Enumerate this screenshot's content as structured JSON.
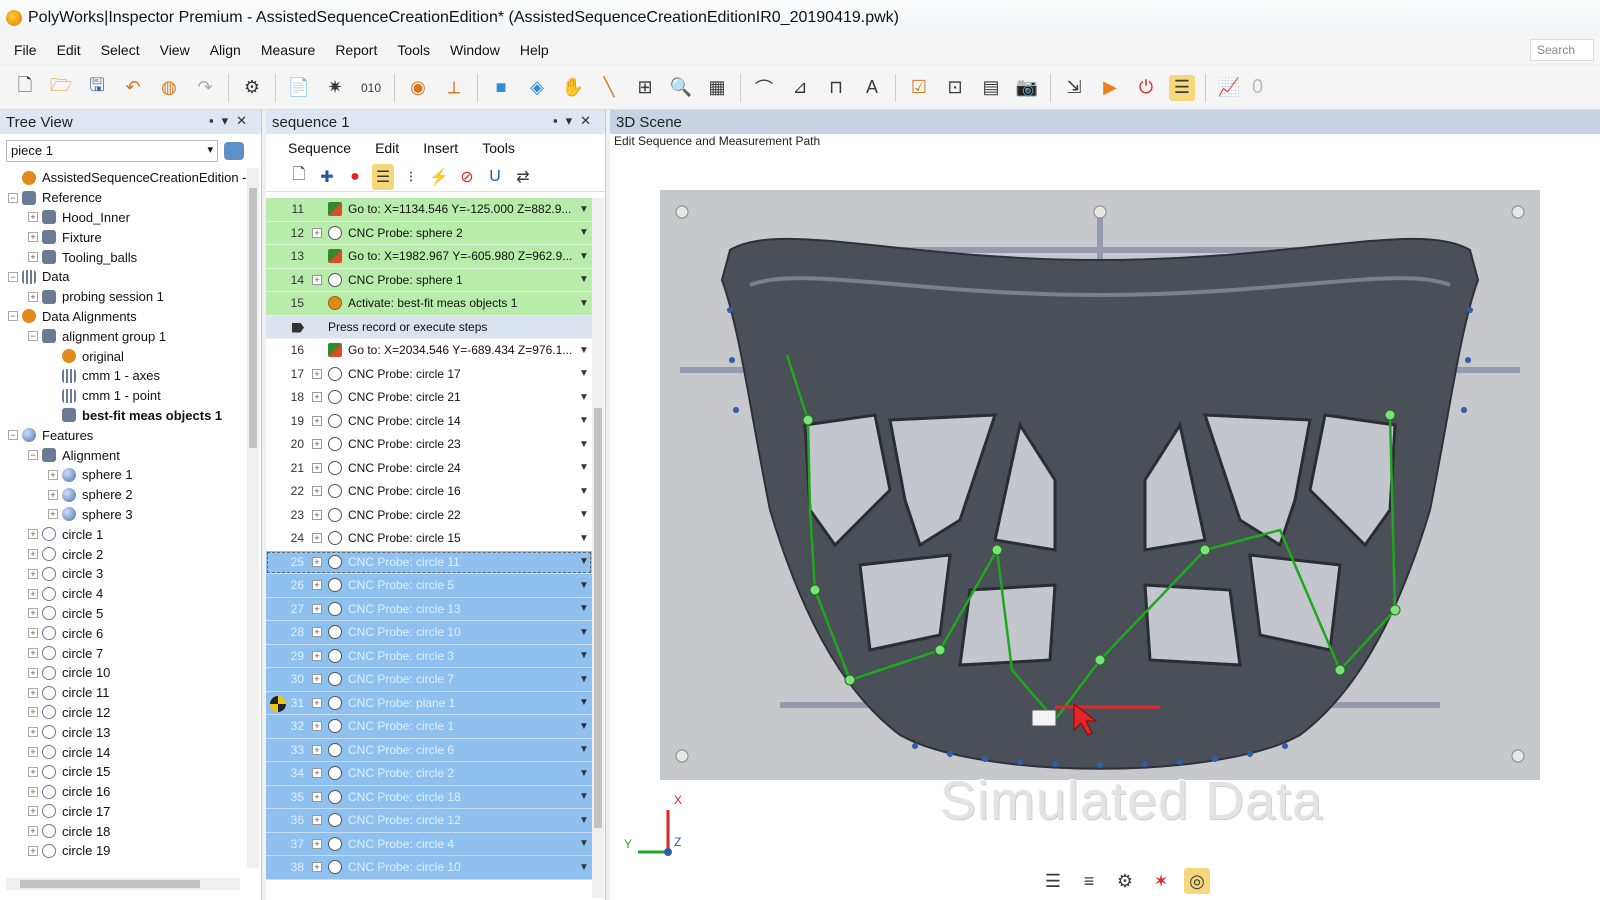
{
  "window": {
    "title": "PolyWorks|Inspector Premium - AssistedSequenceCreationEdition* (AssistedSequenceCreationEditionIR0_20190419.pwk)"
  },
  "menubar": {
    "items": [
      "File",
      "Edit",
      "Select",
      "View",
      "Align",
      "Measure",
      "Report",
      "Tools",
      "Window",
      "Help"
    ],
    "search_label": "Search"
  },
  "toolbar": {
    "counter": "0",
    "icons": [
      "new-icon",
      "open-icon",
      "save-icon",
      "undo-icon",
      "redo-icon",
      "settings-icon",
      "report-icon",
      "probe-icon",
      "cube-icon",
      "camera-icon",
      "record-icon",
      "stop-icon",
      "chart-icon"
    ]
  },
  "tree_panel": {
    "title": "Tree View",
    "piece_value": "piece 1",
    "items": [
      {
        "label": "AssistedSequenceCreationEdition -",
        "indent": 0,
        "exp": "",
        "icon": "orange"
      },
      {
        "label": "Reference",
        "indent": 0,
        "exp": "−",
        "icon": "gear"
      },
      {
        "label": "Hood_Inner",
        "indent": 1,
        "exp": "+",
        "icon": "gear"
      },
      {
        "label": "Fixture",
        "indent": 1,
        "exp": "+",
        "icon": "gear"
      },
      {
        "label": "Tooling_balls",
        "indent": 1,
        "exp": "+",
        "icon": "gear"
      },
      {
        "label": "Data",
        "indent": 0,
        "exp": "−",
        "icon": "grid"
      },
      {
        "label": "probing session 1",
        "indent": 1,
        "exp": "+",
        "icon": "gear"
      },
      {
        "label": "Data Alignments",
        "indent": 0,
        "exp": "−",
        "icon": "orange"
      },
      {
        "label": "alignment group 1",
        "indent": 1,
        "exp": "−",
        "icon": "gear"
      },
      {
        "label": "original",
        "indent": 2,
        "exp": "",
        "icon": "orange"
      },
      {
        "label": "cmm 1 - axes",
        "indent": 2,
        "exp": "",
        "icon": "grid"
      },
      {
        "label": "cmm 1 - point",
        "indent": 2,
        "exp": "",
        "icon": "grid"
      },
      {
        "label": "best-fit meas objects 1",
        "indent": 2,
        "exp": "",
        "icon": "gear",
        "bold": true
      },
      {
        "label": "Features",
        "indent": 0,
        "exp": "−",
        "icon": "sphere"
      },
      {
        "label": "Alignment",
        "indent": 1,
        "exp": "−",
        "icon": "gear"
      },
      {
        "label": "sphere 1",
        "indent": 2,
        "exp": "+",
        "icon": "sphere"
      },
      {
        "label": "sphere 2",
        "indent": 2,
        "exp": "+",
        "icon": "sphere"
      },
      {
        "label": "sphere 3",
        "indent": 2,
        "exp": "+",
        "icon": "sphere"
      },
      {
        "label": "circle 1",
        "indent": 1,
        "exp": "+",
        "icon": "circle"
      },
      {
        "label": "circle 2",
        "indent": 1,
        "exp": "+",
        "icon": "circle"
      },
      {
        "label": "circle 3",
        "indent": 1,
        "exp": "+",
        "icon": "circle"
      },
      {
        "label": "circle 4",
        "indent": 1,
        "exp": "+",
        "icon": "circle"
      },
      {
        "label": "circle 5",
        "indent": 1,
        "exp": "+",
        "icon": "circle"
      },
      {
        "label": "circle 6",
        "indent": 1,
        "exp": "+",
        "icon": "circle"
      },
      {
        "label": "circle 7",
        "indent": 1,
        "exp": "+",
        "icon": "circle"
      },
      {
        "label": "circle 10",
        "indent": 1,
        "exp": "+",
        "icon": "circle"
      },
      {
        "label": "circle 11",
        "indent": 1,
        "exp": "+",
        "icon": "circle"
      },
      {
        "label": "circle 12",
        "indent": 1,
        "exp": "+",
        "icon": "circle"
      },
      {
        "label": "circle 13",
        "indent": 1,
        "exp": "+",
        "icon": "circle"
      },
      {
        "label": "circle 14",
        "indent": 1,
        "exp": "+",
        "icon": "circle"
      },
      {
        "label": "circle 15",
        "indent": 1,
        "exp": "+",
        "icon": "circle"
      },
      {
        "label": "circle 16",
        "indent": 1,
        "exp": "+",
        "icon": "circle"
      },
      {
        "label": "circle 17",
        "indent": 1,
        "exp": "+",
        "icon": "circle"
      },
      {
        "label": "circle 18",
        "indent": 1,
        "exp": "+",
        "icon": "circle"
      },
      {
        "label": "circle 19",
        "indent": 1,
        "exp": "+",
        "icon": "circle"
      }
    ]
  },
  "sequence_panel": {
    "title": "sequence 1",
    "menu": [
      "Sequence",
      "Edit",
      "Insert",
      "Tools"
    ],
    "rows": [
      {
        "num": "11",
        "label": "Go to: X=1134.546 Y=-125.000 Z=882.9...",
        "style": "green",
        "icon": "goto",
        "plus": false
      },
      {
        "num": "12",
        "label": "CNC Probe: sphere 2",
        "style": "green",
        "icon": "sphere",
        "plus": true
      },
      {
        "num": "13",
        "label": "Go to: X=1982.967 Y=-605.980 Z=962.9...",
        "style": "green",
        "icon": "goto",
        "plus": false
      },
      {
        "num": "14",
        "label": "CNC Probe: sphere 1",
        "style": "green",
        "icon": "sphere",
        "plus": true
      },
      {
        "num": "15",
        "label": "Activate: best-fit meas objects 1",
        "style": "green",
        "icon": "act",
        "plus": false
      },
      {
        "num": "",
        "label": "Press record or execute steps",
        "style": "gray",
        "icon": "",
        "plus": false
      },
      {
        "num": "16",
        "label": "Go to: X=2034.546 Y=-689.434 Z=976.1...",
        "style": "white",
        "icon": "goto",
        "plus": false
      },
      {
        "num": "17",
        "label": "CNC Probe: circle 17",
        "style": "white",
        "icon": "circle",
        "plus": true
      },
      {
        "num": "18",
        "label": "CNC Probe: circle 21",
        "style": "white",
        "icon": "circle",
        "plus": true
      },
      {
        "num": "19",
        "label": "CNC Probe: circle 14",
        "style": "white",
        "icon": "circle",
        "plus": true
      },
      {
        "num": "20",
        "label": "CNC Probe: circle 23",
        "style": "white",
        "icon": "circle",
        "plus": true
      },
      {
        "num": "21",
        "label": "CNC Probe: circle 24",
        "style": "white",
        "icon": "circle",
        "plus": true
      },
      {
        "num": "22",
        "label": "CNC Probe: circle 16",
        "style": "white",
        "icon": "circle",
        "plus": true
      },
      {
        "num": "23",
        "label": "CNC Probe: circle 22",
        "style": "white",
        "icon": "circle",
        "plus": true
      },
      {
        "num": "24",
        "label": "CNC Probe: circle 15",
        "style": "white",
        "icon": "circle",
        "plus": true
      },
      {
        "num": "25",
        "label": "CNC Probe: circle 11",
        "style": "blue",
        "icon": "circle",
        "plus": true,
        "dashed": true
      },
      {
        "num": "26",
        "label": "CNC Probe: circle 5",
        "style": "blue",
        "icon": "circle",
        "plus": true
      },
      {
        "num": "27",
        "label": "CNC Probe: circle 13",
        "style": "blue",
        "icon": "circle",
        "plus": true
      },
      {
        "num": "28",
        "label": "CNC Probe: circle 10",
        "style": "blue",
        "icon": "circle",
        "plus": true
      },
      {
        "num": "29",
        "label": "CNC Probe: circle 3",
        "style": "blue",
        "icon": "circle",
        "plus": true
      },
      {
        "num": "30",
        "label": "CNC Probe: circle 7",
        "style": "blue",
        "icon": "circle",
        "plus": true
      },
      {
        "num": "31",
        "label": "CNC Probe: plane 1",
        "style": "blue",
        "icon": "plane",
        "plus": true,
        "marker": true
      },
      {
        "num": "32",
        "label": "CNC Probe: circle 1",
        "style": "blue",
        "icon": "circle",
        "plus": true
      },
      {
        "num": "33",
        "label": "CNC Probe: circle 6",
        "style": "blue",
        "icon": "circle",
        "plus": true
      },
      {
        "num": "34",
        "label": "CNC Probe: circle 2",
        "style": "blue",
        "icon": "circle",
        "plus": true
      },
      {
        "num": "35",
        "label": "CNC Probe: circle 18",
        "style": "blue",
        "icon": "circle",
        "plus": true
      },
      {
        "num": "36",
        "label": "CNC Probe: circle 12",
        "style": "blue",
        "icon": "circle",
        "plus": true
      },
      {
        "num": "37",
        "label": "CNC Probe: circle 4",
        "style": "blue",
        "icon": "circle",
        "plus": true
      },
      {
        "num": "38",
        "label": "CNC Probe: circle 10",
        "style": "blue",
        "icon": "circle",
        "plus": true
      }
    ]
  },
  "scene_panel": {
    "title": "3D Scene",
    "subtitle": "Edit Sequence and Measurement Path",
    "watermark": "Simulated Data",
    "axis_x": "X",
    "axis_y": "Y",
    "axis_z": "Z"
  },
  "colors": {
    "executed_row": "#b7ecab",
    "selected_row": "#8fc1f0",
    "path": "#1fa81f",
    "part": "#4b4f57"
  }
}
